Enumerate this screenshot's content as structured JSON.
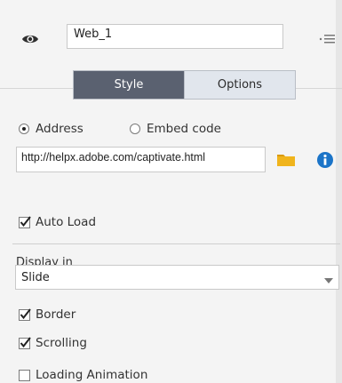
{
  "header": {
    "name_value": "Web_1",
    "tabs": [
      {
        "label": "Style",
        "active": true
      },
      {
        "label": "Options",
        "active": false
      }
    ]
  },
  "source": {
    "radio_address_label": "Address",
    "radio_embed_label": "Embed code",
    "selected": "Address",
    "url_value": "http://helpx.adobe.com/captivate.html"
  },
  "options": {
    "auto_load_label": "Auto Load",
    "auto_load_checked": true,
    "display_in_label": "Display in",
    "display_in_value": "Slide",
    "border_label": "Border",
    "border_checked": true,
    "scrolling_label": "Scrolling",
    "scrolling_checked": true,
    "loading_animation_label": "Loading Animation",
    "loading_animation_checked": false
  },
  "icons": {
    "eye": "eye-icon",
    "menu": "panel-menu-icon",
    "folder": "folder-icon",
    "info": "info-icon",
    "dropdown": "chevron-down-icon"
  },
  "colors": {
    "active_tab_bg": "#5a6170",
    "folder": "#f0b41c",
    "info": "#1b74c8"
  }
}
